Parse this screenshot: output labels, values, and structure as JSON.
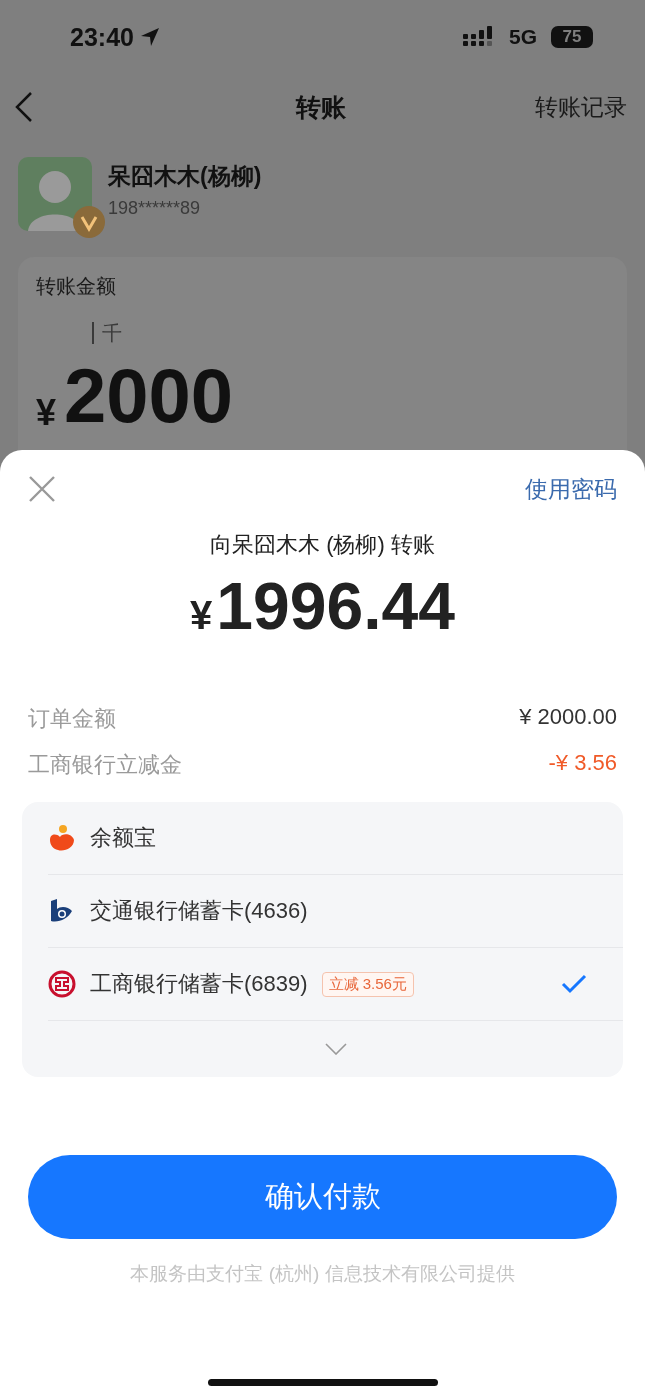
{
  "status_bar": {
    "time": "23:40",
    "network": "5G",
    "battery": "75"
  },
  "nav": {
    "title": "转账",
    "action": "转账记录"
  },
  "payee": {
    "name": "呆囧木木(杨柳)",
    "phone": "198******89"
  },
  "amount_card": {
    "label": "转账金额",
    "unit_hint": "千",
    "currency": "¥",
    "amount": "2000"
  },
  "sheet": {
    "action": "使用密码",
    "title": "向呆囧木木 (杨柳) 转账",
    "currency": "¥",
    "amount": "1996.44",
    "lines": [
      {
        "label": "订单金额",
        "value": "¥ 2000.00",
        "kind": "normal"
      },
      {
        "label": "工商银行立减金",
        "value": "-¥ 3.56",
        "kind": "discount"
      }
    ],
    "methods": [
      {
        "kind": "yeb",
        "name": "余额宝",
        "selected": false
      },
      {
        "kind": "bocom",
        "name": "交通银行储蓄卡(4636)",
        "selected": false
      },
      {
        "kind": "icbc",
        "name": "工商银行储蓄卡(6839)",
        "tag": "立减 3.56元",
        "selected": true
      }
    ],
    "confirm": "确认付款",
    "footer": "本服务由支付宝 (杭州) 信息技术有限公司提供"
  }
}
